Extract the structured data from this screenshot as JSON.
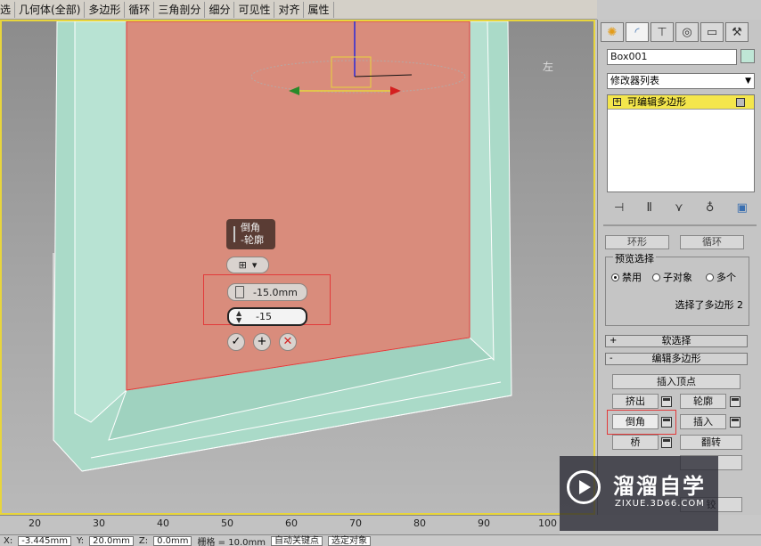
{
  "menu": {
    "items": [
      "选",
      "几何体(全部)",
      "多边形",
      "循环",
      "三角剖分",
      "细分",
      "可见性",
      "对齐",
      "属性"
    ]
  },
  "viewport": {
    "view_cube_label": "左",
    "caddy": {
      "title_line1": "倒角",
      "title_line2": "-轮廓",
      "height_value": "-15.0mm",
      "outline_value": "-15",
      "type_icon": "grid-icon",
      "accept": "✓",
      "apply": "+",
      "cancel": "✕"
    },
    "colors": {
      "frame": "#aadac8",
      "face": "#d98c7c",
      "highlight": "#e23a3a",
      "active_border": "#e8d53c"
    }
  },
  "panel": {
    "tab_icons": [
      "sun-icon",
      "curve-icon",
      "hierarchy-icon",
      "motion-icon",
      "display-icon",
      "hammer-icon"
    ],
    "object_name": "Box001",
    "modifier_list": "修改器列表",
    "stack_entry": "可编辑多边形",
    "stack_tool_icons": [
      "pin-icon",
      "show-end-icon",
      "make-unique-icon",
      "remove-icon",
      "configure-icon"
    ],
    "ring_btn": "环形",
    "loop_btn": "循环",
    "preview_group": "预览选择",
    "preview_options": [
      "禁用",
      "子对象",
      "多个"
    ],
    "status": "选择了多边形 2",
    "soft_select": "软选择",
    "edit_polygons": "编辑多边形",
    "commands": {
      "insert_vertex": "插入顶点",
      "extrude": "挤出",
      "outline": "轮廓",
      "bevel": "倒角",
      "inset": "插入",
      "bridge": "桥",
      "flip": "翻转",
      "partial": "铰"
    }
  },
  "watermark": {
    "title": "溜溜自学",
    "url": "ZIXUE.3D66.COM"
  },
  "timeline": {
    "ticks": [
      "20",
      "30",
      "40",
      "50",
      "60",
      "70",
      "80",
      "90",
      "100"
    ]
  },
  "statusbar": {
    "x_label": "X:",
    "x_value": "-3.445mm",
    "y_label": "Y:",
    "y_value": "20.0mm",
    "z_label": "Z:",
    "z_value": "0.0mm",
    "grid_label": "栅格 = 10.0mm",
    "autokey": "自动关键点",
    "selected": "选定对象"
  }
}
